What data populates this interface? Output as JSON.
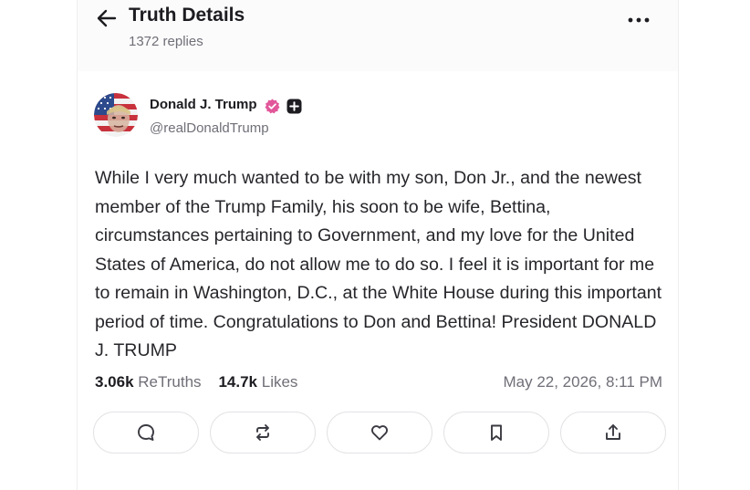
{
  "header": {
    "title": "Truth Details",
    "replies": "1372 replies"
  },
  "post": {
    "author_name": "Donald J. Trump",
    "author_handle": "@realDonaldTrump",
    "body": "While I very much wanted to be with my son, Don Jr., and the newest member of the Trump Family, his soon to be wife, Bettina, circumstances pertaining to Government, and my love for the United States of America, do not allow me to do so. I feel it is important for me to remain in Washington, D.C., at the White House during this important period of time. Congratulations to Don and Bettina! President DONALD J. TRUMP",
    "retruths_count": "3.06k",
    "retruths_label": "ReTruths",
    "likes_count": "14.7k",
    "likes_label": "Likes",
    "timestamp": "May 22, 2026, 8:11 PM"
  },
  "icons": {
    "back": "arrow-left-icon",
    "more": "more-horizontal-icon",
    "verified": "verified-badge-icon",
    "plus": "plus-badge-icon",
    "reply": "comment-icon",
    "retruth": "repost-icon",
    "like": "heart-icon",
    "bookmark": "bookmark-icon",
    "share": "share-icon"
  },
  "colors": {
    "verified_badge": "#e2579a",
    "text_primary": "#1c1c21",
    "text_secondary": "#6f6f78",
    "button_border": "#e3e3e6"
  }
}
